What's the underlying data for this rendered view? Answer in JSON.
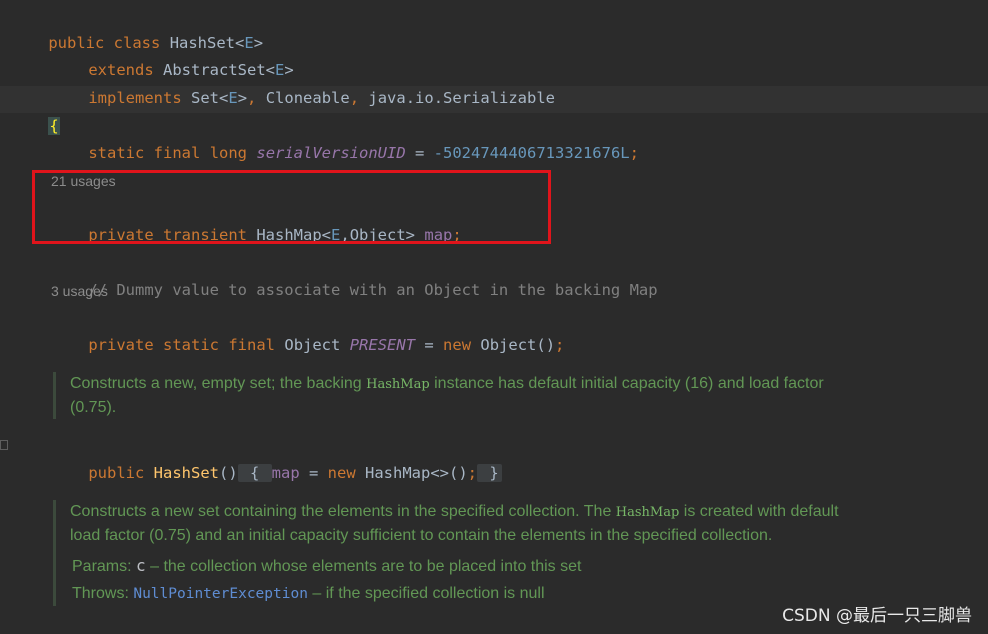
{
  "code": {
    "l1": {
      "kw1": "public",
      "kw2": "class",
      "name": "HashSet",
      "lt": "<",
      "tp": "E",
      "gt": ">"
    },
    "l2": {
      "kw": "extends",
      "name": "AbstractSet",
      "lt": "<",
      "tp": "E",
      "gt": ">"
    },
    "l3": {
      "kw": "implements",
      "set": "Set",
      "lt": "<",
      "tp": "E",
      "gt": ">",
      "sep1": ", ",
      "clone": "Cloneable",
      "sep2": ", ",
      "ser": "java.io.Serializable"
    },
    "l4": {
      "brace": "{"
    },
    "l5": {
      "kw1": "static",
      "kw2": "final",
      "kw3": "long",
      "field": "serialVersionUID",
      "eq": " = ",
      "val": "-5024744406713321676L",
      "semi": ";"
    },
    "usages1": "21 usages",
    "l6": {
      "kw1": "private",
      "kw2": "transient",
      "type": "HashMap",
      "lt": "<",
      "tp": "E",
      "rest": ",Object> ",
      "field": "map",
      "semi": ";"
    },
    "l7": {
      "comment": "// Dummy value to associate with an Object in the backing Map"
    },
    "usages2": "3 usages",
    "l8": {
      "kw1": "private",
      "kw2": "static",
      "kw3": "final",
      "type": "Object",
      "field": "PRESENT",
      "eq": " = ",
      "kw4": "new",
      "call": "Object()",
      "semi": ";"
    },
    "l9": {
      "kw": "public",
      "fn": "HashSet",
      "paren": "()",
      "fold_open": " { ",
      "field": "map",
      "eq": " = ",
      "kw2": "new",
      "call": "HashMap<>()",
      "semi": ";",
      "fold_close": " }"
    }
  },
  "doc1": {
    "t1": "Constructs a new, empty set; the backing ",
    "code": "HashMap",
    "t2": " instance has default initial capacity (16) and load factor (0.75)."
  },
  "doc2": {
    "t1": "Constructs a new set containing the elements in the specified collection. The ",
    "code": "HashMap",
    "t2": " is created with default load factor (0.75) and an initial capacity sufficient to contain the elements in the specified collection.",
    "params_label": "Params: ",
    "params_code": "c",
    "params_text": " – the collection whose elements are to be placed into this set",
    "throws_label": "Throws: ",
    "throws_code": "NullPointerException",
    "throws_text": " – if the specified collection is null"
  },
  "watermark": "CSDN @最后一只三脚兽"
}
